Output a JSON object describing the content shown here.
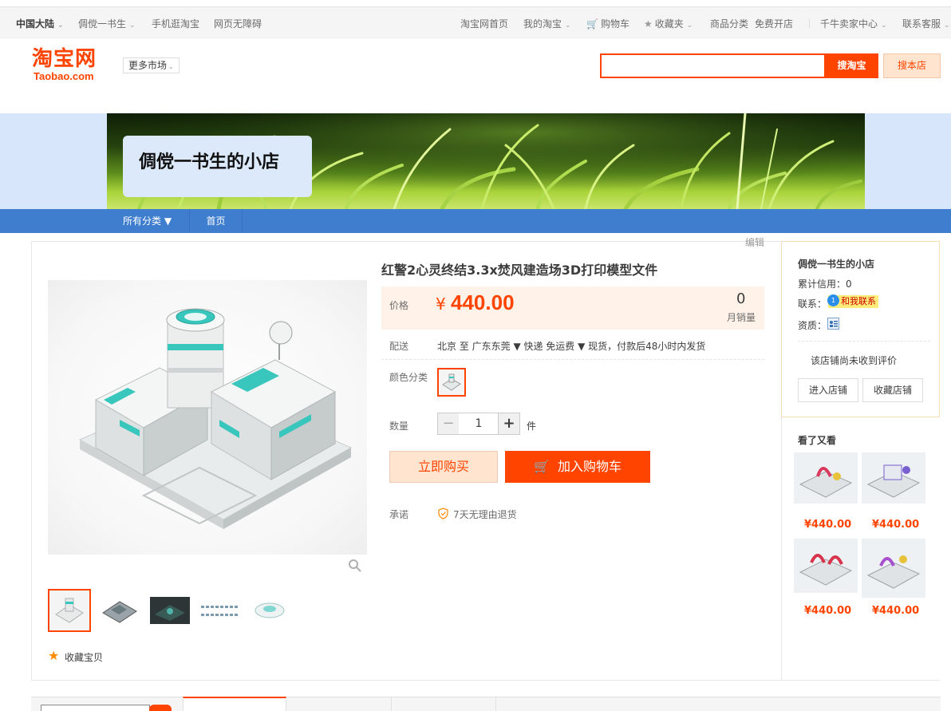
{
  "topbar": {
    "region": "中国大陆",
    "user": "倜傥一书生",
    "mobile": "手机逛淘宝",
    "accessibility": "网页无障碍",
    "home": "淘宝网首页",
    "my_taobao": "我的淘宝",
    "cart": "购物车",
    "favorites": "收藏夹",
    "categories": "商品分类",
    "open_shop": "免费开店",
    "seller_center": "千牛卖家中心",
    "customer_service": "联系客服"
  },
  "header": {
    "logo_cn": "淘宝网",
    "logo_en": "Taobao.com",
    "more_markets": "更多市场",
    "search_value": "",
    "search_taobao": "搜淘宝",
    "search_shop": "搜本店"
  },
  "shop": {
    "name": "倜傥一书生的小店",
    "nav": {
      "all_categories": "所有分类 ▼",
      "home": "首页"
    }
  },
  "product": {
    "edit": "编辑",
    "title": "红警2心灵终结3.3x焚风建造场3D打印模型文件",
    "price_label": "价格",
    "currency": "¥",
    "price": "440.00",
    "monthly_sales": "0",
    "monthly_sales_label": "月销量",
    "delivery_label": "配送",
    "delivery": "北京 至  广东东莞 ▼   快递 免运费 ▼   现货，付款后48小时内发货",
    "color_label": "颜色分类",
    "quantity_label": "数量",
    "quantity": "1",
    "quantity_unit": "件",
    "buy_now": "立即购买",
    "add_to_cart": "加入购物车",
    "promise_label": "承诺",
    "promise": "7天无理由退货",
    "favorite": "收藏宝贝"
  },
  "shop_card": {
    "name": "倜傥一书生的小店",
    "credit": "累计信用：0",
    "contact_label": "联系：",
    "contact_badge": "和我联系",
    "qualification_label": "资质：",
    "no_review": "该店铺尚未收到评价",
    "enter_shop": "进入店铺",
    "favorite_shop": "收藏店铺"
  },
  "also_viewed": {
    "title": "看了又看",
    "items": [
      {
        "price": "¥440.00",
        "color": "#d93a5e"
      },
      {
        "price": "¥440.00",
        "color": "#7a5fd0"
      },
      {
        "price": "¥440.00",
        "color": "#d8344c"
      },
      {
        "price": "¥440.00",
        "color": "#a84fd0"
      }
    ]
  },
  "colors": {
    "accent": "#ff4400",
    "shop_nav": "#3f7ecf",
    "banner_bg": "#d7e6fa",
    "teal": "#39c6bc"
  }
}
